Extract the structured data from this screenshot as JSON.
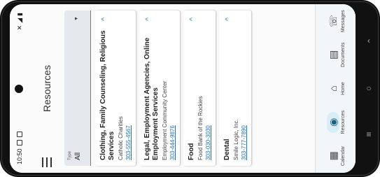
{
  "status_bar": {
    "time": "10:50"
  },
  "app_bar": {
    "title": "Resources"
  },
  "filter": {
    "label": "Type",
    "value": "All"
  },
  "cards": [
    {
      "title": "Clothing, Family Counseling, Religious Services",
      "org": "Catholic Charities",
      "phone": "303-555-4567"
    },
    {
      "title": "Legal, Employment Agencies, Online Employment Services",
      "org": "Employment Community Center",
      "phone": "303-444-9876"
    },
    {
      "title": "Food",
      "org": "Food Bank of the Rockies",
      "phone": "303-030-3030"
    },
    {
      "title": "Dental",
      "org": "Smile Logic, Inc.",
      "phone": "303-777-7890"
    }
  ],
  "bottom_nav": [
    {
      "label": "Calendar",
      "icon": "calendar-icon"
    },
    {
      "label": "Resources",
      "icon": "location-pin-icon",
      "active": true
    },
    {
      "label": "Home",
      "icon": "home-icon"
    },
    {
      "label": "Documents",
      "icon": "folder-icon"
    },
    {
      "label": "Messages",
      "icon": "chat-icon"
    }
  ],
  "colors": {
    "accent": "#2a7c9c",
    "link": "#1a73c9",
    "nav_active_bg": "#d8eef7"
  }
}
